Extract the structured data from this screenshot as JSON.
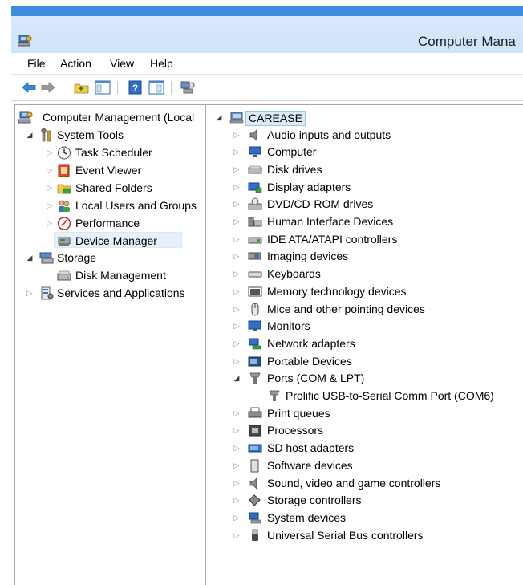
{
  "window": {
    "title": "Computer Mana"
  },
  "menu": [
    "File",
    "Action",
    "View",
    "Help"
  ],
  "toolbar": {
    "buttons": [
      "back-arrow-icon",
      "forward-arrow-icon",
      "up-folder-icon",
      "show-hide-tree-icon",
      "help-icon",
      "show-hide-action-pane-icon",
      "device-properties-icon"
    ]
  },
  "left_tree": {
    "root": "Computer Management (Local",
    "system_tools": "System Tools",
    "task_scheduler": "Task Scheduler",
    "event_viewer": "Event Viewer",
    "shared_folders": "Shared Folders",
    "local_users": "Local Users and Groups",
    "performance": "Performance",
    "device_manager": "Device Manager",
    "storage": "Storage",
    "disk_management": "Disk Management",
    "services": "Services and Applications"
  },
  "devices": {
    "root": "CAREASE",
    "categories": [
      "Audio inputs and outputs",
      "Computer",
      "Disk drives",
      "Display adapters",
      "DVD/CD-ROM drives",
      "Human Interface Devices",
      "IDE ATA/ATAPI controllers",
      "Imaging devices",
      "Keyboards",
      "Memory technology devices",
      "Mice and other pointing devices",
      "Monitors",
      "Network adapters",
      "Portable Devices",
      "Ports (COM & LPT)",
      "Prolific USB-to-Serial Comm Port (COM6)",
      "Print queues",
      "Processors",
      "SD host adapters",
      "Software devices",
      "Sound, video and game controllers",
      "Storage controllers",
      "System devices",
      "Universal Serial Bus controllers"
    ]
  }
}
